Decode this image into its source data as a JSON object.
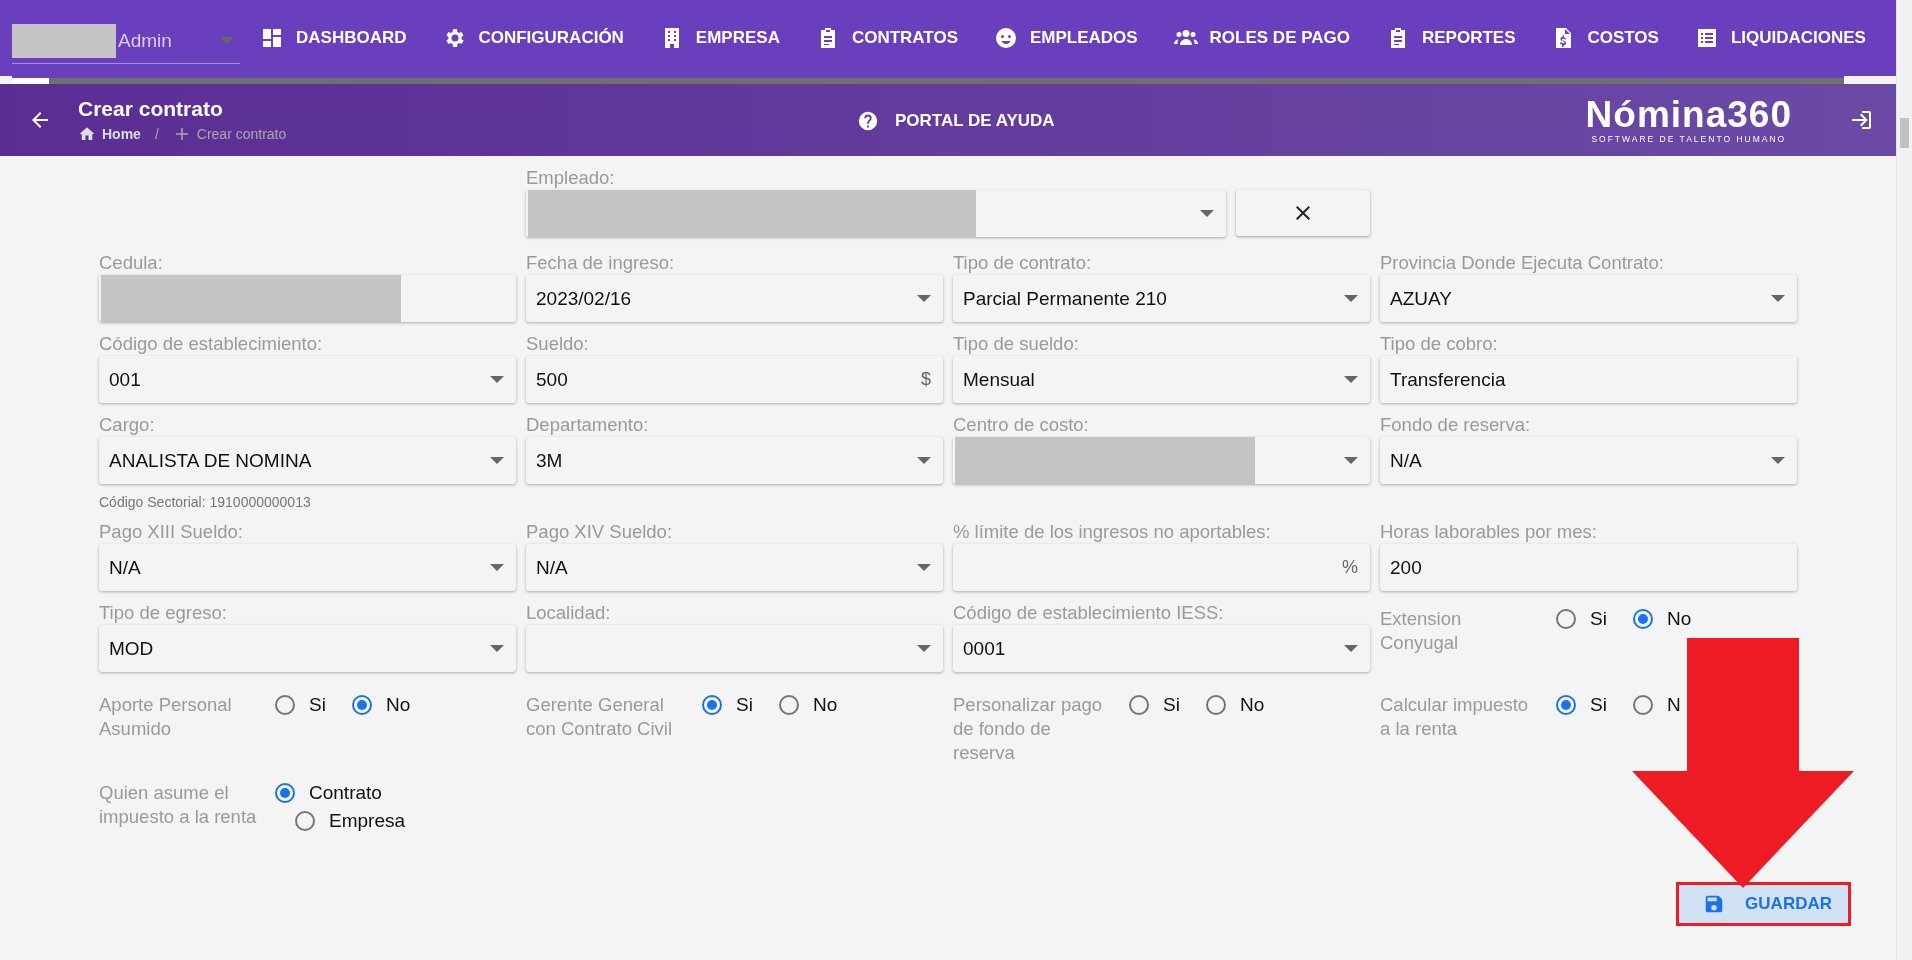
{
  "nav": {
    "user": {
      "name": "Admin",
      "redacted": true
    },
    "items": [
      {
        "label": "DASHBOARD",
        "kind": "grid"
      },
      {
        "label": "CONFIGURACIÓN",
        "kind": "gear"
      },
      {
        "label": "EMPRESA",
        "kind": "building"
      },
      {
        "label": "CONTRATOS",
        "kind": "clipboard"
      },
      {
        "label": "EMPLEADOS",
        "kind": "face"
      },
      {
        "label": "ROLES DE PAGO",
        "kind": "people"
      },
      {
        "label": "REPORTES",
        "kind": "clipboard"
      },
      {
        "label": "COSTOS",
        "kind": "invoice"
      },
      {
        "label": "LIQUIDACIONES",
        "kind": "list"
      }
    ],
    "progress": {
      "level": 0.02
    }
  },
  "header": {
    "title": "Crear contrato",
    "breadcrumb": [
      "Home",
      "Crear contrato"
    ],
    "breadcrumb_separator": "/",
    "help": "PORTAL DE AYUDA",
    "logo": {
      "name": "Nómina360",
      "tagline": "SOFTWARE DE TALENTO HUMANO"
    }
  },
  "employee": {
    "label": "Empleado:",
    "redacted": true
  },
  "fields": [
    {
      "kind": "text",
      "label": "Cedula:",
      "redacted": true
    },
    {
      "kind": "select",
      "label": "Fecha de ingreso:",
      "value": "2023/02/16"
    },
    {
      "kind": "select",
      "label": "Tipo de contrato:",
      "value": "Parcial Permanente 210"
    },
    {
      "kind": "select",
      "label": "Provincia Donde Ejecuta Contrato:",
      "value": "AZUAY"
    },
    {
      "kind": "select",
      "label": "Código de establecimiento:",
      "value": "001"
    },
    {
      "kind": "text",
      "label": "Sueldo:",
      "value": "500",
      "suffix": "$"
    },
    {
      "kind": "select",
      "label": "Tipo de sueldo:",
      "value": "Mensual"
    },
    {
      "kind": "text",
      "label": "Tipo de cobro:",
      "value": "Transferencia"
    },
    {
      "kind": "select",
      "label": "Cargo:",
      "value": "ANALISTA DE NOMINA",
      "hint": "Código Sectorial: 1910000000013"
    },
    {
      "kind": "select",
      "label": "Departamento:",
      "value": "3M"
    },
    {
      "kind": "select",
      "label": "Centro de costo:",
      "redacted": true
    },
    {
      "kind": "select",
      "label": "Fondo de reserva:",
      "value": "N/A"
    },
    {
      "kind": "select",
      "label": "Pago XIII Sueldo:",
      "value": "N/A"
    },
    {
      "kind": "select",
      "label": "Pago XIV Sueldo:",
      "value": "N/A"
    },
    {
      "kind": "text",
      "label": "% límite de los ingresos no aportables:",
      "suffix": "%"
    },
    {
      "kind": "text",
      "label": "Horas laborables por mes:",
      "value": "200"
    },
    {
      "kind": "select",
      "label": "Tipo de egreso:",
      "value": "MOD"
    },
    {
      "kind": "select",
      "label": "Localidad:"
    },
    {
      "kind": "select",
      "label": "Código de establecimiento IESS:",
      "value": "0001"
    },
    {
      "kind": "radio",
      "label": "Extension Conyugal",
      "options": [
        {
          "label": "Si",
          "selected": false
        },
        {
          "label": "No",
          "selected": true
        }
      ]
    },
    {
      "kind": "radio",
      "label": "Aporte Personal Asumido",
      "options": [
        {
          "label": "Si",
          "selected": false
        },
        {
          "label": "No",
          "selected": true
        }
      ]
    },
    {
      "kind": "radio",
      "label": "Gerente General con Contrato Civil",
      "options": [
        {
          "label": "Si",
          "selected": true
        },
        {
          "label": "No",
          "selected": false
        }
      ]
    },
    {
      "kind": "radio",
      "label": "Personalizar pago de fondo de reserva",
      "options": [
        {
          "label": "Si",
          "selected": false
        },
        {
          "label": "No",
          "selected": false
        }
      ]
    },
    {
      "kind": "radio",
      "label": "Calcular impuesto a la renta",
      "options": [
        {
          "label": "Si",
          "selected": true
        },
        {
          "label": "N",
          "selected": false
        }
      ]
    },
    {
      "kind": "radio-stack",
      "label": "Quien asume el impuesto a la renta",
      "options": [
        {
          "label": "Contrato",
          "selected": true
        },
        {
          "label": "Empresa",
          "selected": false
        }
      ]
    }
  ],
  "save_button": {
    "label": "GUARDAR",
    "highlighted": true
  },
  "annotation": {
    "kind": "arrow"
  }
}
